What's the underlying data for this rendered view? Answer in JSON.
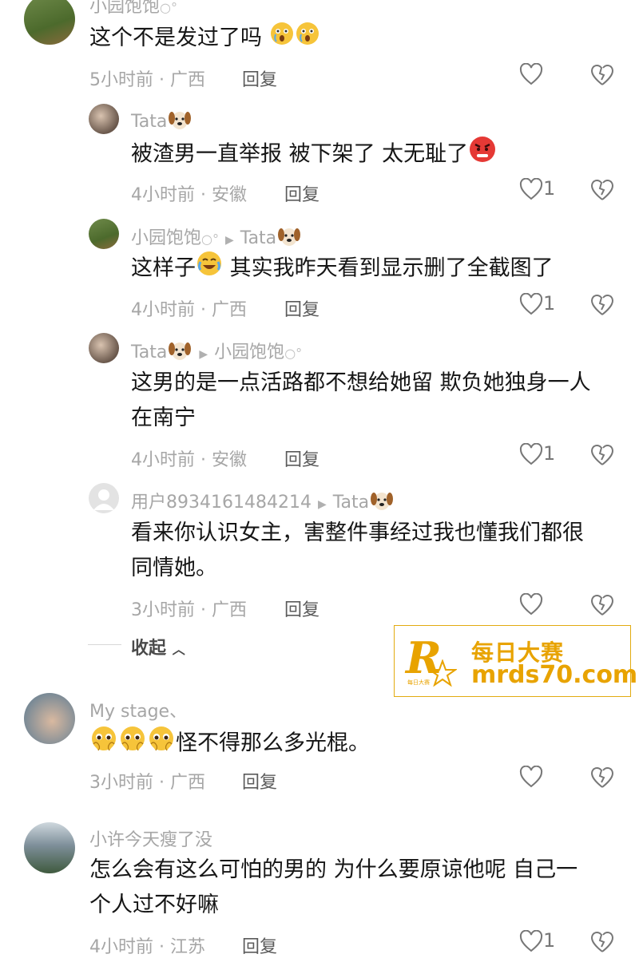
{
  "colors": {
    "name": "#a6a6a6",
    "text": "#161616",
    "reply": "#5b5b5b",
    "watermark": "#e8a300"
  },
  "comments": [
    {
      "user": "小园饱饱",
      "text": "这个不是发过了吗",
      "time": "5小时前 · 广西",
      "reply": "回复",
      "likes": ""
    },
    {
      "user": "Tata",
      "text": "被渣男一直举报 被下架了 太无耻了",
      "time": "4小时前 · 安徽",
      "reply": "回复",
      "likes": "1"
    },
    {
      "user": "小园饱饱",
      "reply_to": "Tata",
      "text": "这样子",
      "text2": "其实我昨天看到显示删了全截图了",
      "time": "4小时前 · 广西",
      "reply": "回复",
      "likes": "1"
    },
    {
      "user": "Tata",
      "reply_to": "小园饱饱",
      "text": "这男的是一点活路都不想给她留 欺负她独身一人",
      "text2": "在南宁",
      "time": "4小时前 · 安徽",
      "reply": "回复",
      "likes": "1"
    },
    {
      "user": "用户8934161484214",
      "reply_to": "Tata",
      "text": "看来你认识女主，害整件事经过我也懂我们都很",
      "text2": "同情她。",
      "time": "3小时前 · 广西",
      "reply": "回复",
      "likes": ""
    },
    {
      "user": "My  stage、",
      "text": "怪不得那么多光棍。",
      "time": "3小时前 · 广西",
      "reply": "回复",
      "likes": ""
    },
    {
      "user": "小许今天瘦了没",
      "text": "怎么会有这么可怕的男的 为什么要原谅他呢 自己一",
      "text2": "个人过不好嘛",
      "time": "4小时前 · 江苏",
      "reply": "回复",
      "likes": "1"
    }
  ],
  "collapse_label": "收起",
  "watermark": {
    "cn": "每日大赛",
    "en": "mrds70.com",
    "logo": "R",
    "small": "每日大赛"
  }
}
